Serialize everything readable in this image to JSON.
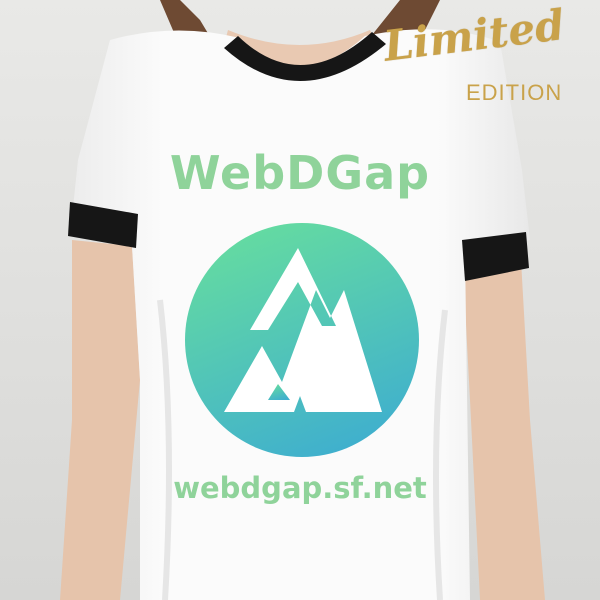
{
  "brand": {
    "name": "WebDGap",
    "url": "webdgap.sf.net"
  },
  "badge": {
    "limited": "Limited",
    "edition": "EDITION"
  },
  "colors": {
    "brand_green": "#8fd39a",
    "logo_top": "#63dca0",
    "logo_bottom": "#42b3cc",
    "badge_gold": "#c9a24a",
    "shirt": "#fbfbfb",
    "trim": "#161616",
    "hair": "#6e4a33",
    "skin": "#e9c9b2"
  }
}
